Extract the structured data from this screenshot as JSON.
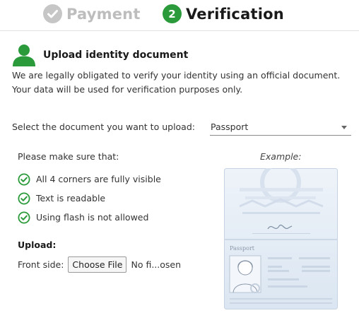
{
  "stepper": {
    "steps": [
      {
        "label": "Payment",
        "state": "done"
      },
      {
        "label": "Verification",
        "number": "2",
        "state": "active"
      }
    ]
  },
  "header": {
    "title": "Upload identity document",
    "description": "We are legally obligated to verify your identity using an official document. Your data will be used for verification purposes only."
  },
  "document_select": {
    "label": "Select the document you want to upload:",
    "value": "Passport"
  },
  "checklist": {
    "title": "Please make sure that:",
    "items": [
      "All 4 corners are fully visible",
      "Text is readable",
      "Using flash is not allowed"
    ]
  },
  "upload": {
    "title": "Upload:",
    "front_label": "Front side:",
    "button_label": "Choose File",
    "file_status": "No fi...osen"
  },
  "example": {
    "label": "Example:",
    "passport_word": "Passport"
  },
  "colors": {
    "accent_green": "#2a9a3a",
    "done_gray": "#c6c6c6"
  },
  "icons": {
    "step_done": "check-circle-icon",
    "header": "user-icon",
    "checklist": "check-circle-outline-icon"
  }
}
